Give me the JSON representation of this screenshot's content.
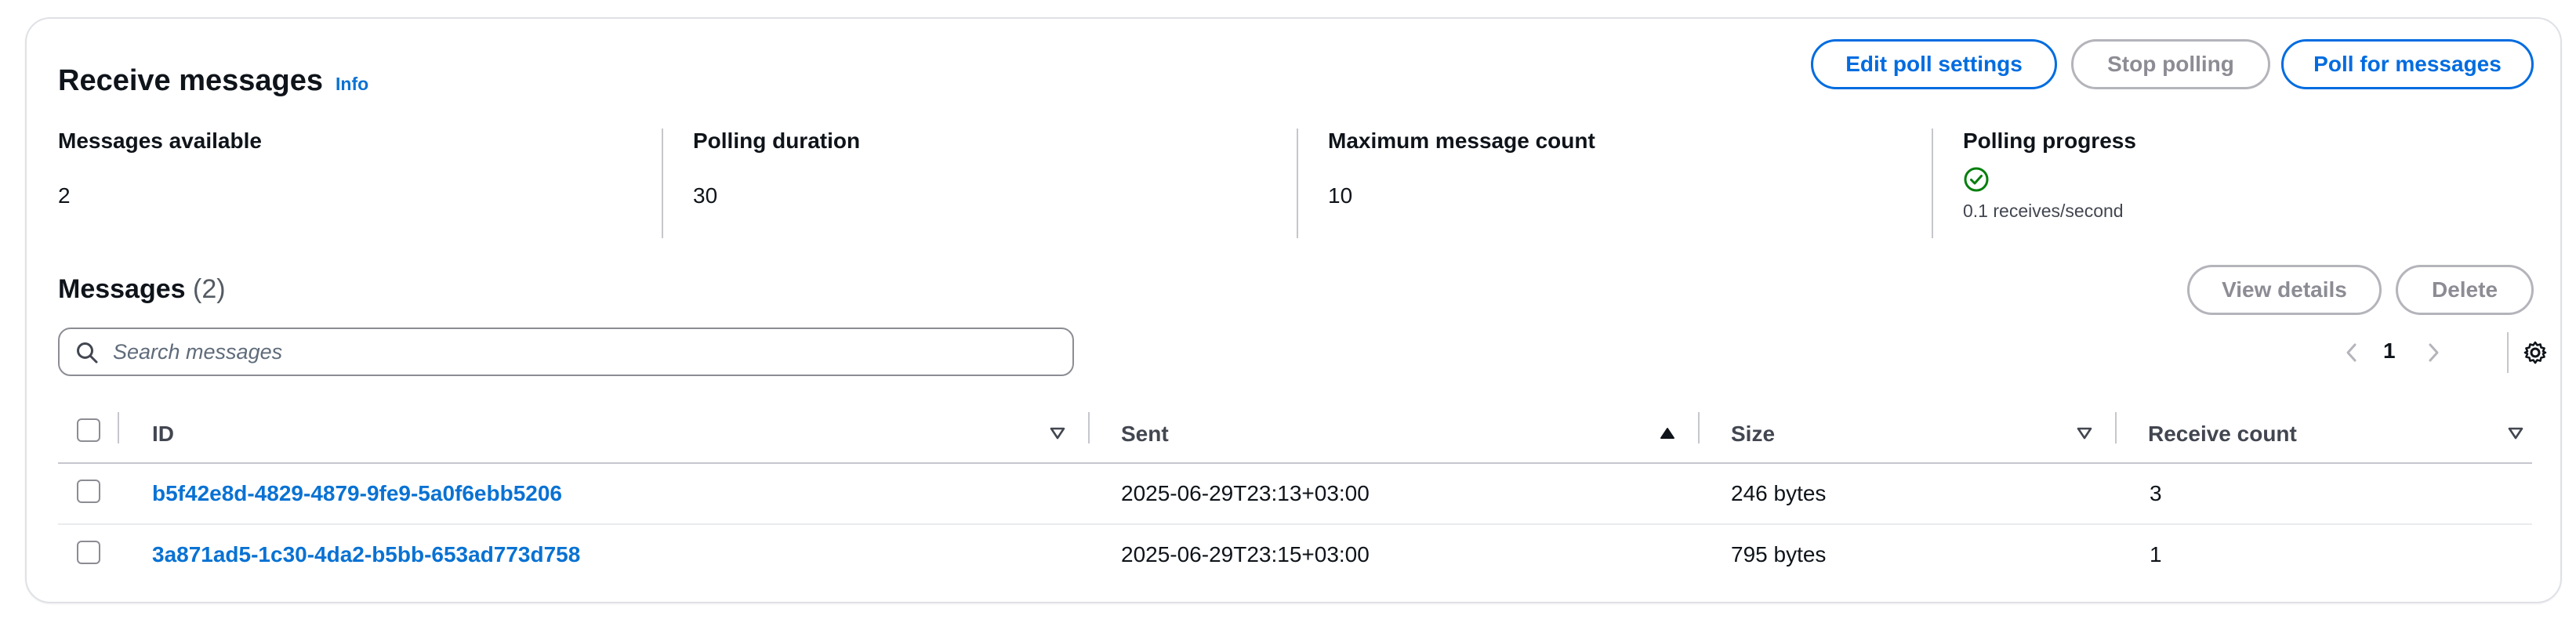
{
  "header": {
    "title": "Receive messages",
    "info_label": "Info",
    "buttons": {
      "edit_poll_settings": "Edit poll settings",
      "stop_polling": "Stop polling",
      "poll_for_messages": "Poll for messages"
    }
  },
  "stats": {
    "messages_available": {
      "label": "Messages available",
      "value": "2"
    },
    "polling_duration": {
      "label": "Polling duration",
      "value": "30"
    },
    "maximum_message_count": {
      "label": "Maximum message count",
      "value": "10"
    },
    "polling_progress": {
      "label": "Polling progress",
      "rate": "0.1 receives/second",
      "status_icon": "check-circle-icon"
    }
  },
  "messages": {
    "title": "Messages",
    "count": "(2)",
    "view_details_label": "View details",
    "delete_label": "Delete",
    "search_placeholder": "Search messages",
    "page_number": "1",
    "columns": [
      "ID",
      "Sent",
      "Size",
      "Receive count"
    ],
    "rows": [
      {
        "id": "b5f42e8d-4829-4879-9fe9-5a0f6ebb5206",
        "sent": "2025-06-29T23:13+03:00",
        "size": "246 bytes",
        "receive_count": "3"
      },
      {
        "id": "3a871ad5-1c30-4da2-b5bb-653ad773d758",
        "sent": "2025-06-29T23:15+03:00",
        "size": "795 bytes",
        "receive_count": "1"
      }
    ]
  },
  "colors": {
    "accent": "#006ce0",
    "link": "#0972d3",
    "success": "#037f0c",
    "disabled": "#8c8c94"
  }
}
